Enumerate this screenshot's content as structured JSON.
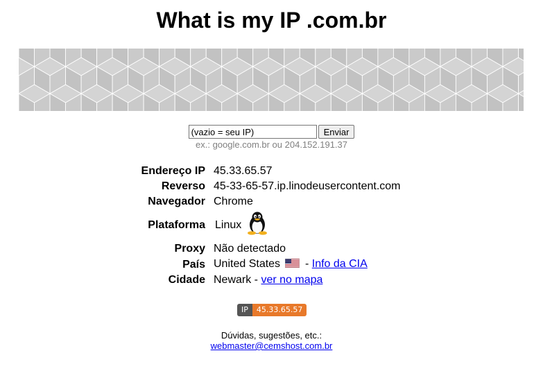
{
  "page": {
    "title": "What is my IP .com.br"
  },
  "search": {
    "value": "(vazio = seu IP)",
    "button_label": "Enviar",
    "hint": "ex.: google.com.br ou 204.152.191.37"
  },
  "info": {
    "ip_label": "Endereço IP",
    "ip_value": "45.33.65.57",
    "reverse_label": "Reverso",
    "reverse_value": "45-33-65-57.ip.linodeusercontent.com",
    "browser_label": "Navegador",
    "browser_value": "Chrome",
    "platform_label": "Plataforma",
    "platform_value": "Linux",
    "platform_icon": "tux-penguin-icon",
    "proxy_label": "Proxy",
    "proxy_value": "Não detectado",
    "country_label": "País",
    "country_value": "United States",
    "country_flag_icon": "us-flag-icon",
    "country_separator": "-",
    "country_link": "Info da CIA",
    "city_label": "Cidade",
    "city_value": "Newark -",
    "city_link": "ver no mapa"
  },
  "badge": {
    "left": "IP",
    "right": "45.33.65.57",
    "left_color": "#555555",
    "right_color": "#e8792a"
  },
  "footer": {
    "text": "Dúvidas, sugestões, etc.:",
    "email": "webmaster@cemshost.com.br"
  },
  "colors": {
    "link": "#0000ee",
    "hint": "#808080",
    "banner": "#c9c9c9"
  }
}
